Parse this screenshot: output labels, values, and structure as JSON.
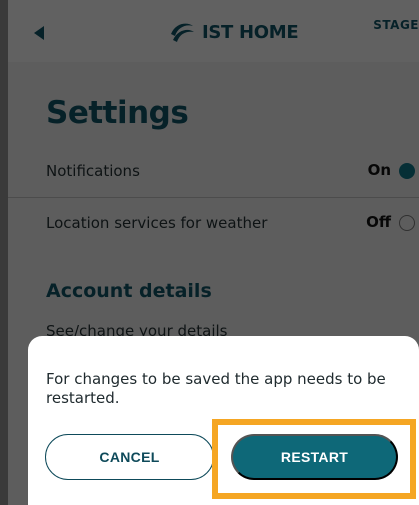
{
  "header": {
    "brand": "IST HOME",
    "stage": "STAGE",
    "back_icon": "back-arrow-icon",
    "logo_icon": "swirl-logo-icon",
    "brand_color": "#0e4a5a"
  },
  "settings": {
    "title": "Settings",
    "rows": [
      {
        "label": "Notifications",
        "value": "On",
        "state": "on"
      },
      {
        "label": "Location services for weather",
        "value": "Off",
        "state": "off"
      }
    ],
    "account_section": "Account details",
    "account_link": "See/change your details"
  },
  "dialog": {
    "message": "For changes to be saved the app needs to be restarted.",
    "cancel_label": "CANCEL",
    "restart_label": "RESTART",
    "accent": "#0e6878",
    "highlight_color": "#f5a623"
  }
}
